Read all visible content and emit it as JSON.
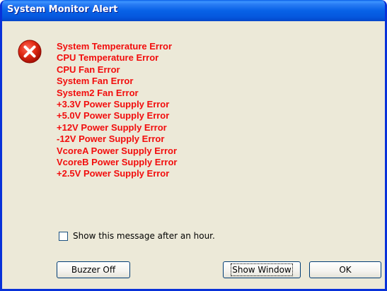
{
  "window": {
    "title": "System Monitor Alert"
  },
  "icon": "error-x-icon",
  "errors": [
    "System Temperature Error",
    "CPU Temperature Error",
    "CPU Fan Error",
    "System Fan Error",
    "System2 Fan Error",
    "+3.3V Power Supply Error",
    "+5.0V Power Supply Error",
    "+12V Power Supply Error",
    "-12V Power Supply Error",
    "VcoreA Power Supply Error",
    "VcoreB Power Supply Error",
    "+2.5V Power Supply Error"
  ],
  "checkbox": {
    "label": "Show this message after an hour.",
    "checked": false
  },
  "buttons": {
    "buzzer_off": "Buzzer Off",
    "show_window": "Show Window",
    "ok": "OK"
  },
  "colors": {
    "error_text": "#f20d0d",
    "title_bar": "#0862e7",
    "dialog_bg": "#ece9d8"
  }
}
